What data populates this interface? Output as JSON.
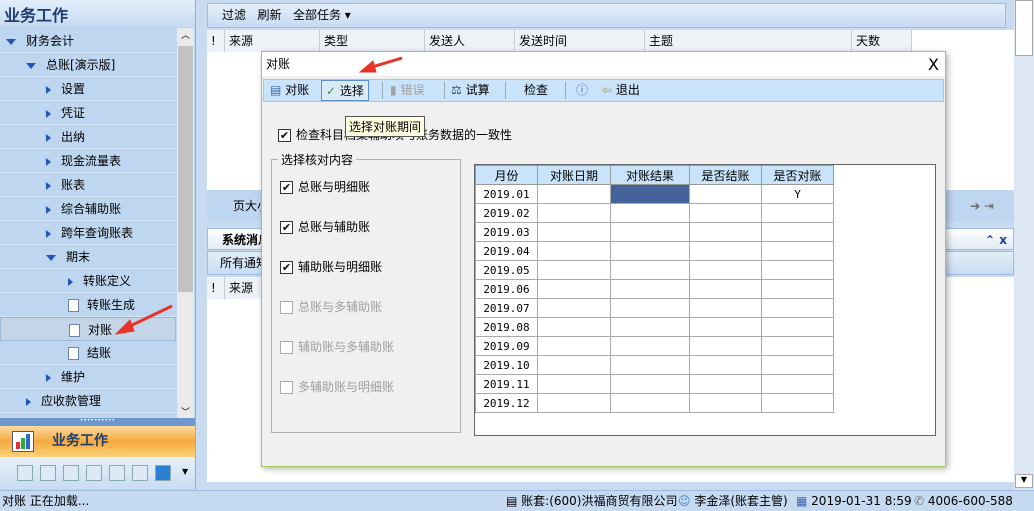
{
  "sidebar": {
    "title": "业务工作",
    "items": [
      {
        "label": "财务会计",
        "level": 0,
        "type": "expanded"
      },
      {
        "label": "总账[演示版]",
        "level": 1,
        "type": "expanded"
      },
      {
        "label": "设置",
        "level": 2,
        "type": "collapsed"
      },
      {
        "label": "凭证",
        "level": 2,
        "type": "collapsed"
      },
      {
        "label": "出纳",
        "level": 2,
        "type": "collapsed"
      },
      {
        "label": "现金流量表",
        "level": 2,
        "type": "collapsed"
      },
      {
        "label": "账表",
        "level": 2,
        "type": "collapsed"
      },
      {
        "label": "综合辅助账",
        "level": 2,
        "type": "collapsed"
      },
      {
        "label": "跨年查询账表",
        "level": 2,
        "type": "collapsed"
      },
      {
        "label": "期末",
        "level": 2,
        "type": "expanded"
      },
      {
        "label": "转账定义",
        "level": 3,
        "type": "collapsed"
      },
      {
        "label": "转账生成",
        "level": 3,
        "type": "doc"
      },
      {
        "label": "对账",
        "level": 3,
        "type": "doc",
        "selected": true
      },
      {
        "label": "结账",
        "level": 3,
        "type": "doc"
      },
      {
        "label": "维护",
        "level": 2,
        "type": "collapsed"
      },
      {
        "label": "应收款管理",
        "level": 1,
        "type": "collapsed"
      }
    ],
    "bottom_label": "业务工作"
  },
  "tasks": {
    "toolbar": [
      "过滤",
      "刷新",
      "全部任务 ▾"
    ],
    "columns": [
      "!",
      "来源",
      "类型",
      "发送人",
      "发送时间",
      "主题",
      "天数"
    ],
    "pager": "页大小"
  },
  "messages": {
    "tab": "系统消息",
    "filter": "所有通知",
    "columns": [
      "!",
      "来源"
    ]
  },
  "dialog": {
    "title": "对账",
    "close": "X",
    "toolbar": [
      {
        "label": "对账",
        "icon": "reconcile-icon"
      },
      {
        "label": "选择",
        "icon": "check-icon",
        "active": true
      },
      {
        "label": "错误",
        "icon": "error-icon",
        "disabled": true
      },
      {
        "label": "试算",
        "icon": "balance-icon"
      },
      {
        "label": "检查"
      },
      {
        "label": "help",
        "icon": "help-icon"
      },
      {
        "label": "退出",
        "icon": "exit-icon"
      }
    ],
    "tooltip": "选择对账期间",
    "check_consistency": "检查科目档案辅助项与账务数据的一致性",
    "group_title": "选择核对内容",
    "options": [
      {
        "label": "总账与明细账",
        "checked": true,
        "enabled": true
      },
      {
        "label": "总账与辅助账",
        "checked": true,
        "enabled": true
      },
      {
        "label": "辅助账与明细账",
        "checked": true,
        "enabled": true
      },
      {
        "label": "总账与多辅助账",
        "checked": false,
        "enabled": false
      },
      {
        "label": "辅助账与多辅助账",
        "checked": false,
        "enabled": false
      },
      {
        "label": "多辅助账与明细账",
        "checked": false,
        "enabled": false
      }
    ],
    "table": {
      "columns": [
        "月份",
        "对账日期",
        "对账结果",
        "是否结账",
        "是否对账"
      ],
      "rows": [
        [
          "2019.01",
          "",
          "",
          "",
          "Y"
        ],
        [
          "2019.02",
          "",
          "",
          "",
          ""
        ],
        [
          "2019.03",
          "",
          "",
          "",
          ""
        ],
        [
          "2019.04",
          "",
          "",
          "",
          ""
        ],
        [
          "2019.05",
          "",
          "",
          "",
          ""
        ],
        [
          "2019.06",
          "",
          "",
          "",
          ""
        ],
        [
          "2019.07",
          "",
          "",
          "",
          ""
        ],
        [
          "2019.08",
          "",
          "",
          "",
          ""
        ],
        [
          "2019.09",
          "",
          "",
          "",
          ""
        ],
        [
          "2019.10",
          "",
          "",
          "",
          ""
        ],
        [
          "2019.11",
          "",
          "",
          "",
          ""
        ],
        [
          "2019.12",
          "",
          "",
          "",
          ""
        ]
      ]
    }
  },
  "status": {
    "left": "对账 正在加载...",
    "account": "账套:(600)洪福商贸有限公司",
    "user": "李金泽(账套主管)",
    "datetime": "2019-01-31 8:59",
    "phone": "4006-600-588"
  },
  "colors": {
    "accent": "#f6a93e",
    "selected_cell": "#44639a",
    "arrow": "#e8332a"
  }
}
